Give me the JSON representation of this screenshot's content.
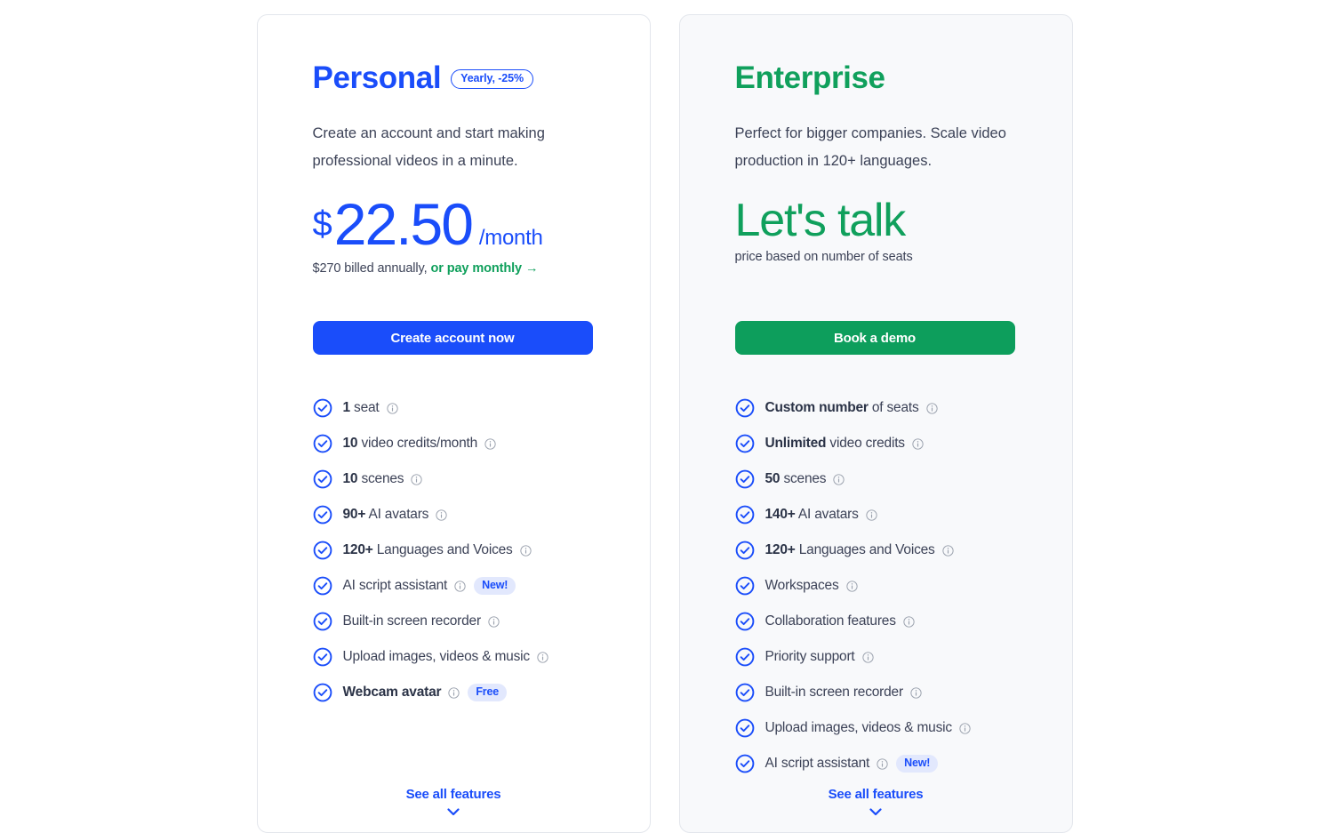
{
  "colors": {
    "blue": "#1a4dfa",
    "green": "#10a05c",
    "green_button": "#0d9e5c",
    "text": "#3c4257",
    "tag_bg": "#e2e8fd",
    "card_border": "#e3e6ec",
    "card_bg_enterprise": "#f8f9fb"
  },
  "plans": [
    {
      "name": "Personal",
      "badge": "Yearly, -25%",
      "description": "Create an account and start making professional videos in a minute.",
      "price": {
        "currency": "$",
        "amount": "22.50",
        "period": "/month",
        "note_prefix": "$270 billed annually,",
        "note_link": "or pay monthly →"
      },
      "cta": "Create account now",
      "features": [
        {
          "bold": "1",
          "text": " seat",
          "info": true,
          "tag": ""
        },
        {
          "bold": "10",
          "text": " video credits/month",
          "info": true,
          "tag": ""
        },
        {
          "bold": "10",
          "text": " scenes",
          "info": true,
          "tag": ""
        },
        {
          "bold": "90+",
          "text": " AI avatars",
          "info": true,
          "tag": ""
        },
        {
          "bold": "120+",
          "text": " Languages and Voices",
          "info": true,
          "tag": ""
        },
        {
          "bold": "",
          "text": "AI script assistant",
          "info": true,
          "tag": "New!"
        },
        {
          "bold": "",
          "text": "Built-in screen recorder",
          "info": true,
          "tag": ""
        },
        {
          "bold": "",
          "text": "Upload images, videos & music",
          "info": true,
          "tag": ""
        },
        {
          "bold": "Webcam avatar",
          "text": "",
          "info": true,
          "tag": "Free"
        }
      ],
      "see_all": "See all features"
    },
    {
      "name": "Enterprise",
      "badge": "",
      "description": "Perfect for bigger companies. Scale video production in 120+ languages.",
      "price": {
        "headline": "Let's talk",
        "note": "price based on number of seats"
      },
      "cta": "Book a demo",
      "features": [
        {
          "bold": "Custom number",
          "text": " of seats",
          "info": true,
          "tag": ""
        },
        {
          "bold": "Unlimited",
          "text": " video credits",
          "info": true,
          "tag": ""
        },
        {
          "bold": "50",
          "text": " scenes",
          "info": true,
          "tag": ""
        },
        {
          "bold": "140+",
          "text": " AI avatars",
          "info": true,
          "tag": ""
        },
        {
          "bold": "120+",
          "text": " Languages and Voices",
          "info": true,
          "tag": ""
        },
        {
          "bold": "",
          "text": "Workspaces",
          "info": true,
          "tag": ""
        },
        {
          "bold": "",
          "text": "Collaboration features",
          "info": true,
          "tag": ""
        },
        {
          "bold": "",
          "text": "Priority support",
          "info": true,
          "tag": ""
        },
        {
          "bold": "",
          "text": "Built-in screen recorder",
          "info": true,
          "tag": ""
        },
        {
          "bold": "",
          "text": "Upload images, videos & music",
          "info": true,
          "tag": ""
        },
        {
          "bold": "",
          "text": "AI script assistant",
          "info": true,
          "tag": "New!"
        }
      ],
      "see_all": "See all features"
    }
  ],
  "icons": {
    "check": "check-circle-icon",
    "info": "info-icon",
    "chevron": "chevron-down-icon",
    "arrow": "arrow-right-icon"
  }
}
